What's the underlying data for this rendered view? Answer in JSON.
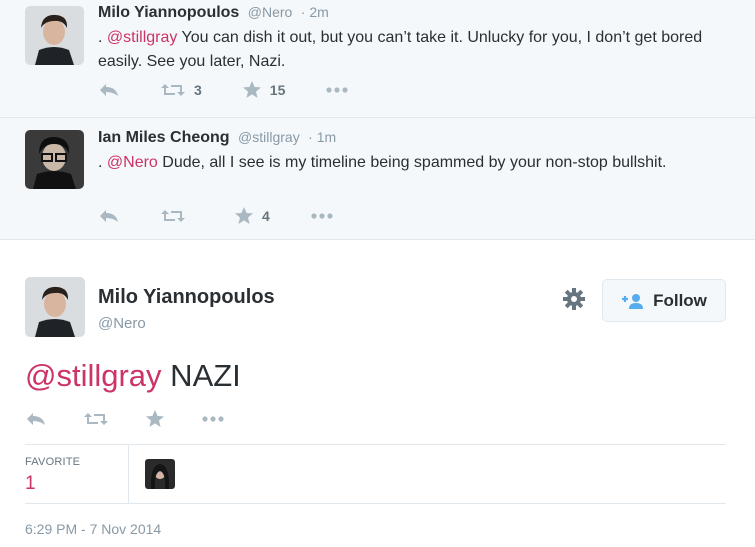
{
  "context_tweets": [
    {
      "name": "Milo Yiannopoulos",
      "handle": "@Nero",
      "time": "· 2m",
      "prefix": ". ",
      "mention": "@stillgray",
      "text": " You can dish it out, but you can’t take it. Unlucky for you, I don’t get bored easily. See you later, Nazi.",
      "retweets": "3",
      "favorites": "15"
    },
    {
      "name": "Ian Miles Cheong",
      "handle": "@stillgray",
      "time": "· 1m",
      "prefix": ". ",
      "mention": "@Nero",
      "text": " Dude, all I see is my timeline being spammed by your non-stop bullshit.",
      "retweets": "",
      "favorites": "4"
    }
  ],
  "main_tweet": {
    "name": "Milo Yiannopoulos",
    "handle": "@Nero",
    "follow_label": "Follow",
    "mention": "@stillgray",
    "text": " NAZI",
    "favorite_label": "FAVORITE",
    "favorite_count": "1",
    "timestamp": "6:29 PM - 7 Nov 2014"
  },
  "icons": [
    "reply-icon",
    "retweet-icon",
    "favorite-icon",
    "more-icon",
    "gear-icon",
    "follow-person-icon"
  ],
  "colors": {
    "mention": "#cc3366",
    "muted": "#8899a6",
    "icon": "#aab8c2",
    "context_bg": "#f5f8fa"
  }
}
